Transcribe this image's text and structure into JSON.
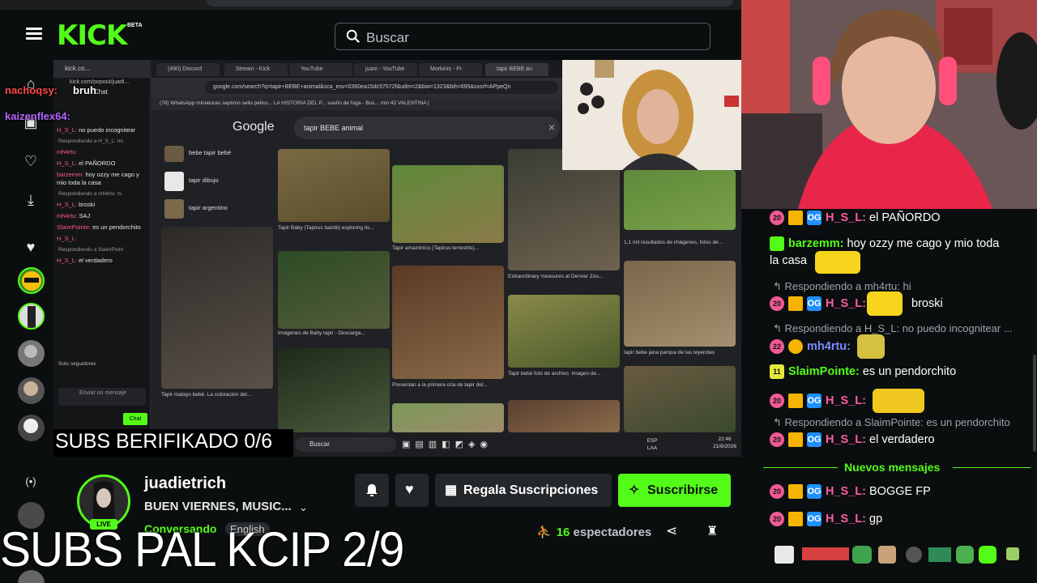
{
  "header": {
    "logo": "KICK",
    "beta": "BETA",
    "search_placeholder": "Buscar"
  },
  "overlay": {
    "subs_verified": "SUBS BERIFIKADO 0/6",
    "subs_kcip": "SUBS PAL KCIP 2/9",
    "chat_overlay": [
      {
        "user": "nachoqsy:",
        "text": "bruh"
      },
      {
        "user": "kaizenflex64:",
        "text": ""
      }
    ]
  },
  "screen_share": {
    "popout_title": "kick.co...",
    "popout_url": "kick.com/popout/juadi...",
    "popout_chat_label": "Chat",
    "popout_lines": [
      {
        "user": "H_S_L:",
        "text": "no puedo incognitear"
      },
      {
        "reply": "Respondiendo a H_S_L: no"
      },
      {
        "user": "mh4rtu:",
        "text": ""
      },
      {
        "user": "H_S_L:",
        "text": "el PAÑORDO"
      },
      {
        "user": "barzemm:",
        "text": "hoy ozzy me cago y mio toda la casa"
      },
      {
        "reply": "Respondiendo a mh4rtu: hi"
      },
      {
        "user": "H_S_L:",
        "text": "broski"
      },
      {
        "user": "mh4rtu:",
        "text": "SAJ"
      },
      {
        "user": "SlaimPointe:",
        "text": "es un pendorchito"
      },
      {
        "user": "H_S_L:",
        "text": ""
      },
      {
        "reply": "Respondiendo a SlaimPoint"
      },
      {
        "user": "H_S_L:",
        "text": "el verdadero"
      }
    ],
    "popout_footer": "Solo seguidores",
    "popout_input": "Enviar un mensaje",
    "popout_send": "Chat",
    "tabs": [
      "(490) Discord",
      "Stream - Kick",
      "YouTube",
      "juani - YouTube",
      "Morkinis - Fr",
      "tapir BEBE an"
    ],
    "url": "google.com/search?q=tapir+BEBE+animal&sca_esv=0360ea15dc57572f&udm=2&biw=1323&bih=695&sxsrf=APpeQn",
    "bookmarks": "(78) WhatsApp   miniaturas   septimo sello pelicu...   LA HISTORIA DEL P...   sueño de fuga - Bus...   min 42   VALENTINA |",
    "google_logo": "Google",
    "google_query": "tapir BEBE animal",
    "suggestions": [
      "bebe tapir bebé",
      "tapir dibujo",
      "tapir argentino"
    ],
    "captions": [
      "Tapir Baby (Tapirus bairdii) exploring its...",
      "Tapir amazónico (Tapirus terrestris)...",
      "1,1 mil resultados de imágenes, fotos de...",
      "Tapir malayo bebé. La coloración del...",
      "Imágenes de Baby tapir - Descarga...",
      "Extraordinary measures at Denver Zoo...",
      "tapir bebe jana parqua de las leyendas",
      "Presentan a la primera cría de tapir del...",
      "Tapir bebé foto de archivo. Imagen de..."
    ],
    "taskbar_search": "Buscar",
    "tray_lang": "ESP LAA",
    "tray_time": "22:46",
    "tray_date": "21/8/2026"
  },
  "channel": {
    "name": "juadietrich",
    "title": "BUEN VIERNES, MUSIC...",
    "live": "LIVE",
    "category": "Conversando",
    "language": "English",
    "gift_label": "Regala Suscripciones",
    "subscribe_label": "Suscribirse",
    "viewers_count": "16",
    "viewers_label": "espectadores"
  },
  "chat": {
    "messages": [
      {
        "type": "msg",
        "user": "H_S_L:",
        "text": "el PAÑORDO",
        "badges": [
          "sub",
          "crown",
          "og"
        ]
      },
      {
        "type": "msg",
        "user": "barzemm:",
        "text": "hoy ozzy me cago y mio toda",
        "text2": "la casa",
        "badges": [
          "gift"
        ]
      },
      {
        "type": "reply",
        "text": "Respondiendo a mh4rtu: hi"
      },
      {
        "type": "msg",
        "user": "H_S_L:",
        "text": "broski",
        "badges": [
          "sub",
          "crown",
          "og"
        ]
      },
      {
        "type": "reply",
        "text": "Respondiendo a H_S_L: no puedo incognitear ..."
      },
      {
        "type": "msg",
        "user": "mh4rtu:",
        "text": "",
        "badges": [
          "sub22",
          "coin"
        ]
      },
      {
        "type": "msg",
        "user": "SlaimPointe:",
        "text": "es un pendorchito",
        "badges": [
          "sub11"
        ]
      },
      {
        "type": "msg",
        "user": "H_S_L:",
        "text": "",
        "badges": [
          "sub",
          "crown",
          "og"
        ]
      },
      {
        "type": "reply",
        "text": "Respondiendo a SlaimPointe: es un pendorchito"
      },
      {
        "type": "msg",
        "user": "H_S_L:",
        "text": "el verdadero",
        "badges": [
          "sub",
          "crown",
          "og"
        ]
      }
    ],
    "new_messages_label": "Nuevos mensajes",
    "new_messages": [
      {
        "user": "H_S_L:",
        "text": "BOGGE FP"
      },
      {
        "user": "H_S_L:",
        "text": "gp"
      }
    ],
    "badge_sub": "20",
    "badge_sub22": "22",
    "badge_sub11": "11",
    "badge_og": "OG",
    "colors": {
      "accent": "#53fc18",
      "pink": "#ff5ba5",
      "blue": "#7a8cff"
    }
  }
}
